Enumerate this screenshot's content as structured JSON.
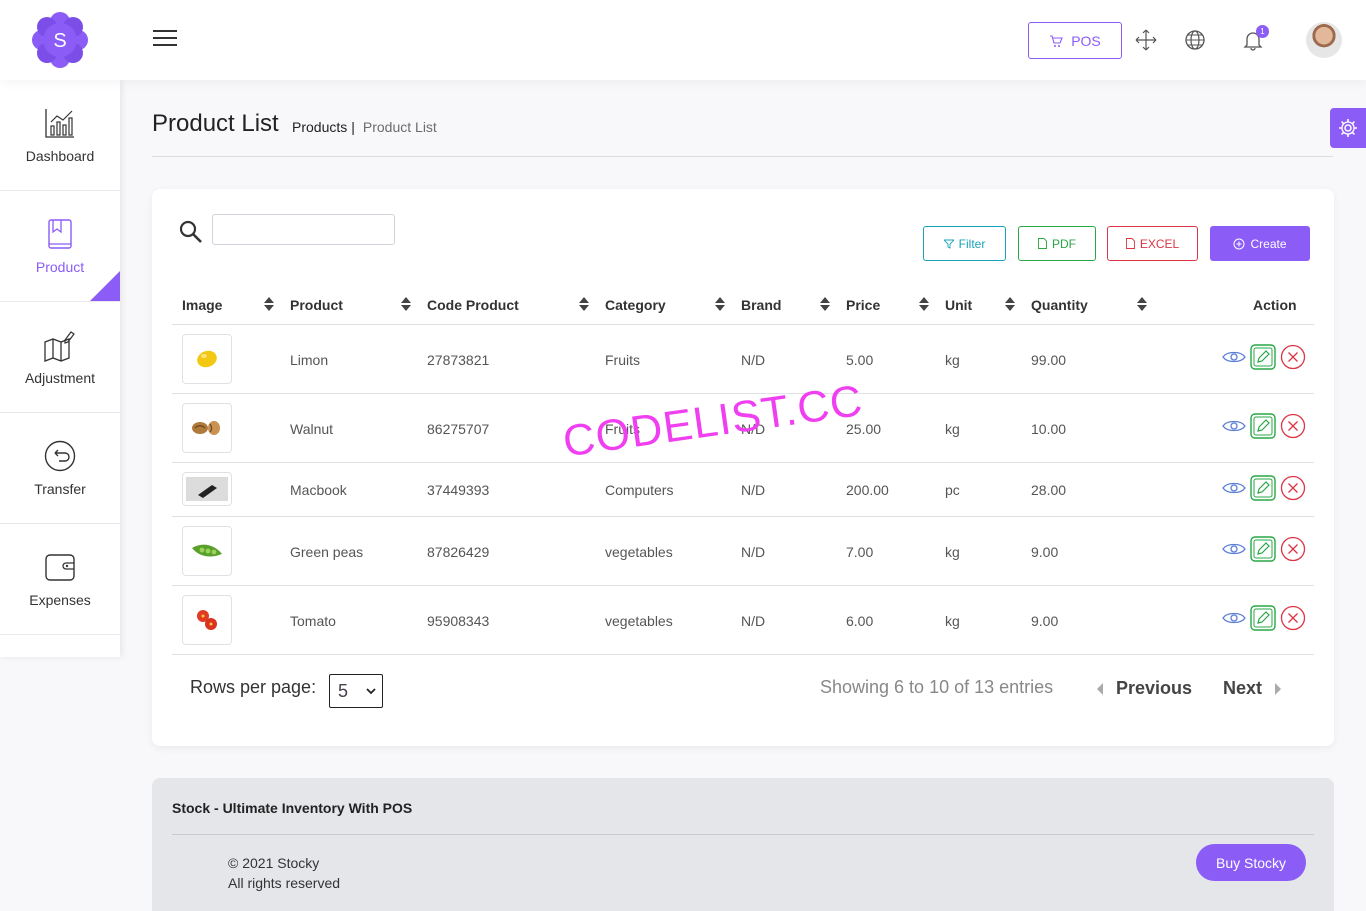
{
  "header": {
    "logo_letter": "S",
    "pos_label": "POS",
    "notification_count": "1"
  },
  "sidebar": {
    "items": [
      {
        "label": "Dashboard",
        "icon": "bar-chart-icon"
      },
      {
        "label": "Product",
        "icon": "product-book-icon"
      },
      {
        "label": "Adjustment",
        "icon": "adjustment-map-icon"
      },
      {
        "label": "Transfer",
        "icon": "transfer-arrow-icon"
      },
      {
        "label": "Expenses",
        "icon": "wallet-icon"
      }
    ],
    "active_index": 1
  },
  "page": {
    "title": "Product List",
    "breadcrumb": {
      "parent": "Products",
      "separator": "|",
      "current": "Product List"
    }
  },
  "toolbar": {
    "filter_label": "Filter",
    "pdf_label": "PDF",
    "excel_label": "EXCEL",
    "create_label": "Create"
  },
  "table": {
    "columns": [
      "Image",
      "Product",
      "Code Product",
      "Category",
      "Brand",
      "Price",
      "Unit",
      "Quantity",
      "Action"
    ],
    "rows": [
      {
        "image": "lemon",
        "product": "Limon",
        "code": "27873821",
        "category": "Fruits",
        "brand": "N/D",
        "price": "5.00",
        "unit": "kg",
        "quantity": "99.00"
      },
      {
        "image": "walnut",
        "product": "Walnut",
        "code": "86275707",
        "category": "Fruits",
        "brand": "N/D",
        "price": "25.00",
        "unit": "kg",
        "quantity": "10.00"
      },
      {
        "image": "macbook",
        "product": "Macbook",
        "code": "37449393",
        "category": "Computers",
        "brand": "N/D",
        "price": "200.00",
        "unit": "pc",
        "quantity": "28.00"
      },
      {
        "image": "green-peas",
        "product": "Green peas",
        "code": "87826429",
        "category": "vegetables",
        "brand": "N/D",
        "price": "7.00",
        "unit": "kg",
        "quantity": "9.00"
      },
      {
        "image": "tomato",
        "product": "Tomato",
        "code": "95908343",
        "category": "vegetables",
        "brand": "N/D",
        "price": "6.00",
        "unit": "kg",
        "quantity": "9.00"
      }
    ]
  },
  "pagination": {
    "rows_per_page_label": "Rows per page:",
    "rows_per_page_value": "5",
    "showing": "Showing 6 to 10 of 13 entries",
    "previous": "Previous",
    "next": "Next"
  },
  "footer": {
    "title": "Stock - Ultimate Inventory With POS",
    "copyright": "© 2021 Stocky",
    "rights": "All rights reserved",
    "buy_label": "Buy Stocky"
  },
  "watermark": "CODELIST.CC",
  "colors": {
    "accent": "#8b5cf6",
    "info": "#17a2b8",
    "success": "#28a745",
    "danger": "#dc3545"
  }
}
